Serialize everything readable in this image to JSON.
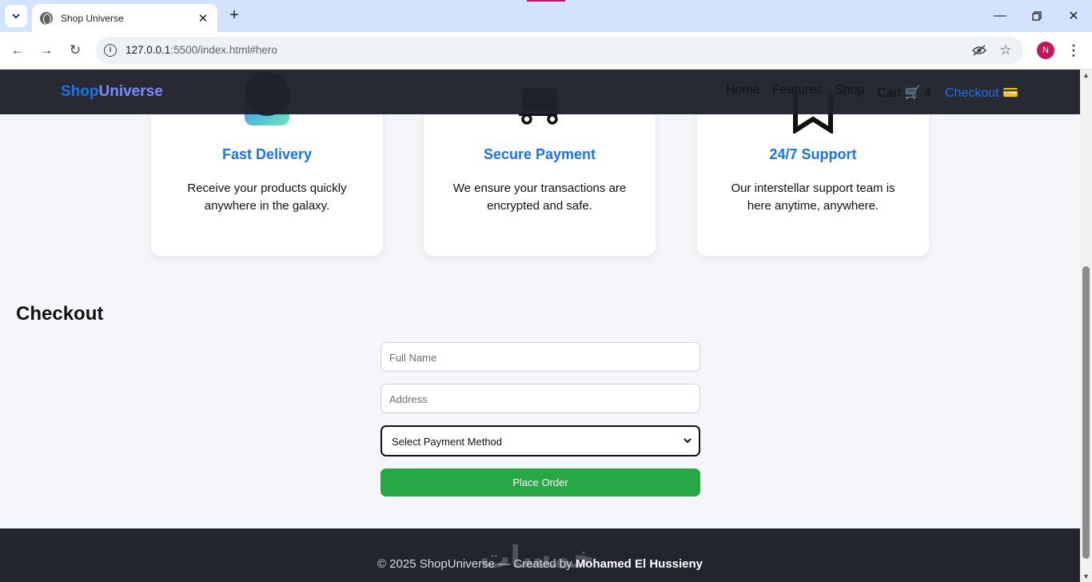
{
  "browser": {
    "tab_title": "Shop Universe",
    "url_host": "127.0.0.1",
    "url_path": ":5500/index.html#hero",
    "profile_initial": "N"
  },
  "header": {
    "logo_part1": "Shop",
    "logo_part2": "Universe",
    "nav": {
      "home": "Home",
      "features": "Features",
      "shop": "Shop",
      "cart": "Cart 🛒",
      "cart_count": "4",
      "checkout": "Checkout 💳"
    }
  },
  "features": [
    {
      "title": "Fast Delivery",
      "text": "Receive your products quickly anywhere in the galaxy."
    },
    {
      "title": "Secure Payment",
      "text": "We ensure your transactions are encrypted and safe."
    },
    {
      "title": "24/7 Support",
      "text": "Our interstellar support team is here anytime, anywhere."
    }
  ],
  "checkout": {
    "title": "Checkout",
    "full_name_placeholder": "Full Name",
    "address_placeholder": "Address",
    "payment_selected": "Select Payment Method",
    "place_order": "Place Order"
  },
  "footer": {
    "text_prefix": "© 2025 ShopUniverse — Created by ",
    "author": "Mohamed El Hussieny",
    "watermark": "خمسات"
  },
  "colors": {
    "accent": "#1a73e8",
    "order_button": "#28a745",
    "header_bg": "#1e212a"
  }
}
